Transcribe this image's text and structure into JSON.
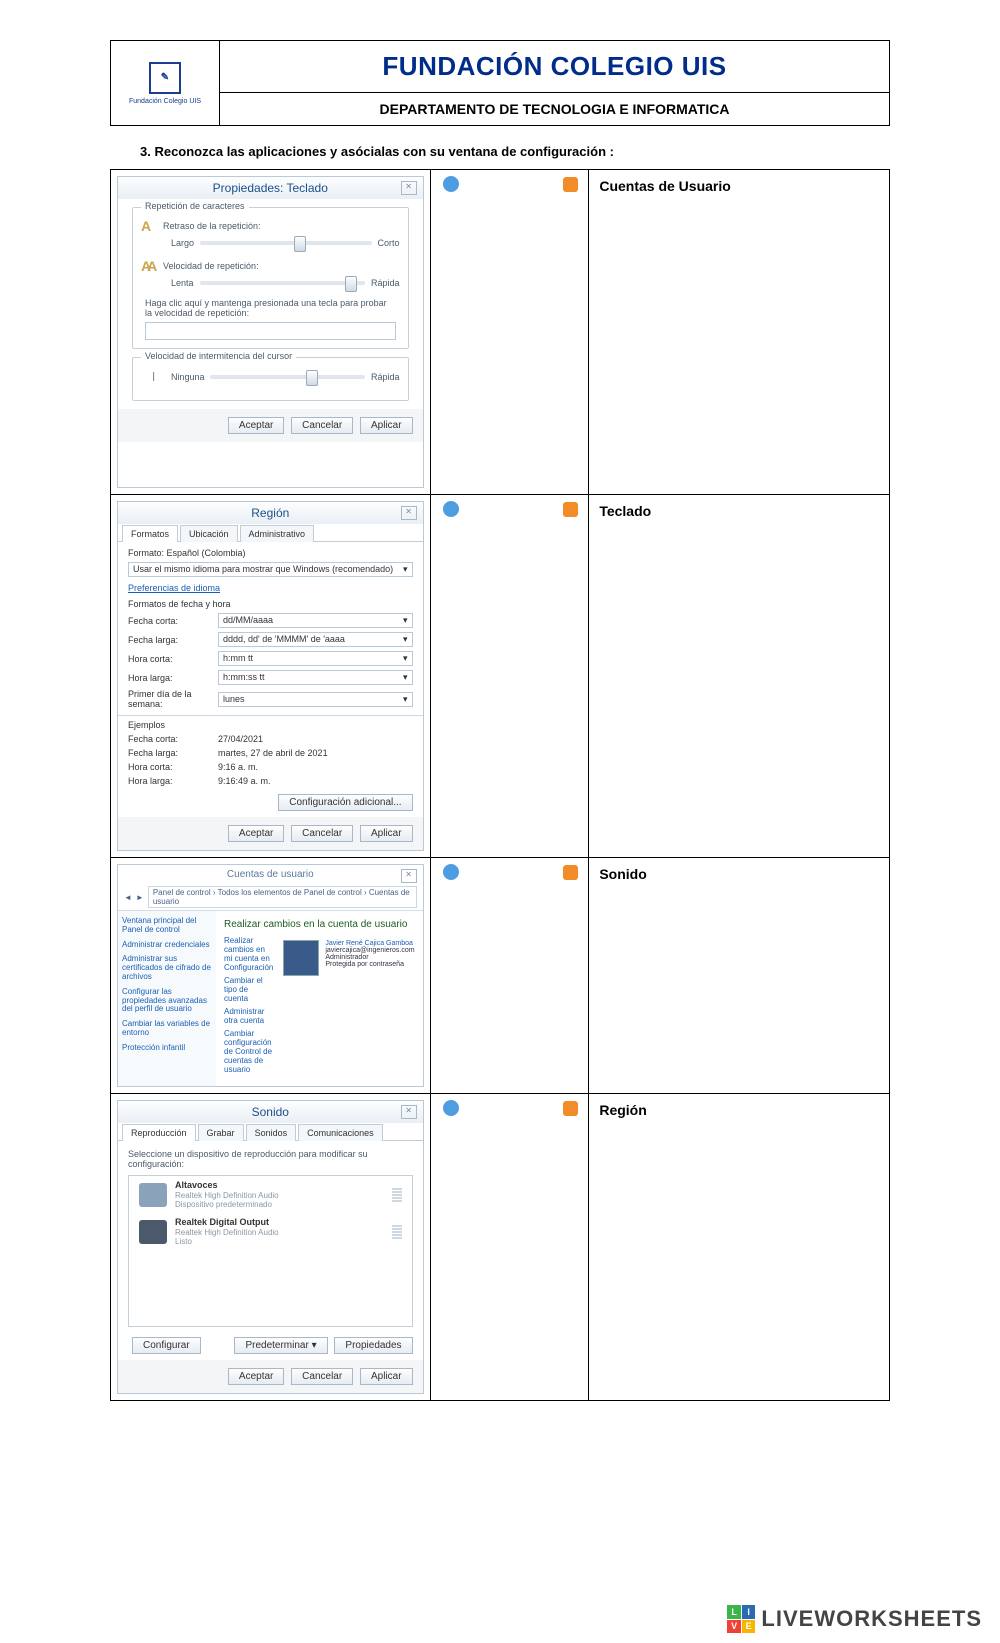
{
  "header": {
    "logoCaption": "Fundación Colegio UIS",
    "title": "FUNDACIÓN COLEGIO UIS",
    "subtitle": "DEPARTAMENTO DE TECNOLOGIA E INFORMATICA"
  },
  "question": "3.   Reconozca las aplicaciones y asócialas con su ventana de configuración :",
  "answers": [
    "Cuentas de Usuario",
    "Teclado",
    "Sonido",
    "Región"
  ],
  "windows": {
    "teclado": {
      "title": "Propiedades: Teclado",
      "group1": "Repetición de caracteres",
      "delayLabel": "Retraso de la repetición:",
      "delayMin": "Largo",
      "delayMax": "Corto",
      "speedLabel": "Velocidad de repetición:",
      "speedMin": "Lenta",
      "speedMax": "Rápida",
      "testHint": "Haga clic aquí y mantenga presionada una tecla para probar la velocidad de repetición:",
      "group2": "Velocidad de intermitencia del cursor",
      "blinkMin": "Ninguna",
      "blinkMax": "Rápida",
      "ok": "Aceptar",
      "cancel": "Cancelar",
      "apply": "Aplicar"
    },
    "region": {
      "title": "Región",
      "tabs": [
        "Formatos",
        "Ubicación",
        "Administrativo"
      ],
      "formatLbl": "Formato: Español (Colombia)",
      "langDropdown": "Usar el mismo idioma para mostrar que Windows (recomendado)",
      "prefLink": "Preferencias de idioma",
      "dtHeader": "Formatos de fecha y hora",
      "rows": [
        {
          "lbl": "Fecha corta:",
          "val": "dd/MM/aaaa"
        },
        {
          "lbl": "Fecha larga:",
          "val": "dddd, dd' de 'MMMM' de 'aaaa"
        },
        {
          "lbl": "Hora corta:",
          "val": "h:mm tt"
        },
        {
          "lbl": "Hora larga:",
          "val": "h:mm:ss tt"
        },
        {
          "lbl": "Primer día de la semana:",
          "val": "lunes"
        }
      ],
      "exHeader": "Ejemplos",
      "examples": [
        {
          "lbl": "Fecha corta:",
          "val": "27/04/2021"
        },
        {
          "lbl": "Fecha larga:",
          "val": "martes, 27 de abril de 2021"
        },
        {
          "lbl": "Hora corta:",
          "val": "9:16 a. m."
        },
        {
          "lbl": "Hora larga:",
          "val": "9:16:49 a. m."
        }
      ],
      "extra": "Configuración adicional...",
      "ok": "Aceptar",
      "cancel": "Cancelar",
      "apply": "Aplicar"
    },
    "cuentas": {
      "title": "Cuentas de usuario",
      "breadcrumb": "Panel de control  ›  Todos los elementos de Panel de control  ›  Cuentas de usuario",
      "sideLinks": [
        "Ventana principal del Panel de control",
        "Administrar credenciales",
        "Administrar sus certificados de cifrado de archivos",
        "Configurar las propiedades avanzadas del perfil de usuario",
        "Cambiar las variables de entorno",
        "Protección infantil"
      ],
      "mainHeader": "Realizar cambios en la cuenta de usuario",
      "mainLinks": [
        "Realizar cambios en mi cuenta en Configuración",
        "Cambiar el tipo de cuenta",
        "Administrar otra cuenta",
        "Cambiar configuración de Control de cuentas de usuario"
      ],
      "userName": "Javier René Cajica Gamboa",
      "userMail": "javiercajica@ingenieros.com",
      "userRole": "Administrador",
      "userProt": "Protegida por contraseña"
    },
    "sonido": {
      "title": "Sonido",
      "tabs": [
        "Reproducción",
        "Grabar",
        "Sonidos",
        "Comunicaciones"
      ],
      "hint": "Seleccione un dispositivo de reproducción para modificar su configuración:",
      "dev1": {
        "name": "Altavoces",
        "line1": "Realtek High Definition Audio",
        "line2": "Dispositivo predeterminado"
      },
      "dev2": {
        "name": "Realtek Digital Output",
        "line1": "Realtek High Definition Audio",
        "line2": "Listo"
      },
      "configure": "Configurar",
      "setdefault": "Predeterminar",
      "props": "Propiedades",
      "ok": "Aceptar",
      "cancel": "Cancelar",
      "apply": "Aplicar"
    }
  },
  "footerBrand": "LIVEWORKSHEETS"
}
